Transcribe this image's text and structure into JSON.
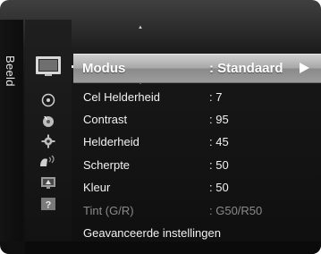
{
  "side_tab": {
    "label": "Beeld"
  },
  "icons": [
    {
      "name": "picture-icon",
      "selected": true
    },
    {
      "name": "sound-icon",
      "selected": false
    },
    {
      "name": "channel-icon",
      "selected": false
    },
    {
      "name": "setup-icon",
      "selected": false
    },
    {
      "name": "input-icon",
      "selected": false
    },
    {
      "name": "application-icon",
      "selected": false
    },
    {
      "name": "support-icon",
      "selected": false
    }
  ],
  "menu": {
    "selected": {
      "label": "Modus",
      "value": ": Standaard"
    },
    "items": [
      {
        "label": "Cel Helderheid",
        "value": ": 7",
        "enabled": true
      },
      {
        "label": "Contrast",
        "value": ": 95",
        "enabled": true
      },
      {
        "label": "Helderheid",
        "value": ": 45",
        "enabled": true
      },
      {
        "label": "Scherpte",
        "value": ": 50",
        "enabled": true
      },
      {
        "label": "Kleur",
        "value": ": 50",
        "enabled": true
      },
      {
        "label": "Tint (G/R)",
        "value": ": G50/R50",
        "enabled": false
      },
      {
        "label": "Geavanceerde instellingen",
        "value": "",
        "enabled": true
      }
    ]
  },
  "colors": {
    "highlight": "#a8a8a8",
    "text": "#f2f2f2",
    "disabled_text": "#8a8a8a",
    "background": "#161616"
  }
}
